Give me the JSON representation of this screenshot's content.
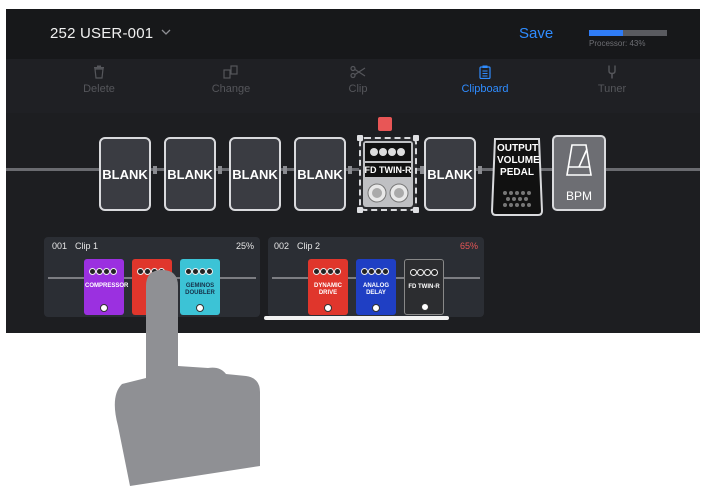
{
  "header": {
    "preset_name": "252 USER-001",
    "save_label": "Save",
    "processor_label": "Processor: 43%",
    "processor_load_fraction": 0.43
  },
  "toolbar": {
    "items": [
      {
        "label": "Delete",
        "icon": "trash-icon",
        "active": false
      },
      {
        "label": "Change",
        "icon": "swap-icon",
        "active": false
      },
      {
        "label": "Clip",
        "icon": "scissors-icon",
        "active": false
      },
      {
        "label": "Clipboard",
        "icon": "clipboard-icon",
        "active": true
      },
      {
        "label": "Tuner",
        "icon": "tuning-fork-icon",
        "active": false
      }
    ]
  },
  "board": {
    "slots": [
      {
        "label": "BLANK"
      },
      {
        "label": "BLANK"
      },
      {
        "label": "BLANK"
      },
      {
        "label": "BLANK"
      },
      {
        "label": "FD TWIN-R"
      },
      {
        "label": "BLANK"
      },
      {
        "label": "OUTPUT VOLUME PEDAL"
      },
      {
        "label": "BPM"
      }
    ]
  },
  "clips": [
    {
      "number": "001",
      "name": "Clip 1",
      "percent": "25%",
      "pedals": [
        {
          "name": "COMPRESSOR",
          "color": "#9b30e0"
        },
        {
          "name": "",
          "color": "#e0362c"
        },
        {
          "name": "GEMINOS DOUBLER",
          "color": "#3cc3d6"
        }
      ]
    },
    {
      "number": "002",
      "name": "Clip 2",
      "percent": "65%",
      "pedals": [
        {
          "name": "DYNAMIC DRIVE",
          "color": "#e0362c"
        },
        {
          "name": "ANALOG DELAY",
          "color": "#1f3fc4"
        },
        {
          "name": "FD TWIN-R",
          "color": "#2c2d30"
        }
      ]
    }
  ],
  "colors": {
    "accent": "#2f8cff",
    "warning": "#e85656",
    "background": "#1c1d20"
  }
}
